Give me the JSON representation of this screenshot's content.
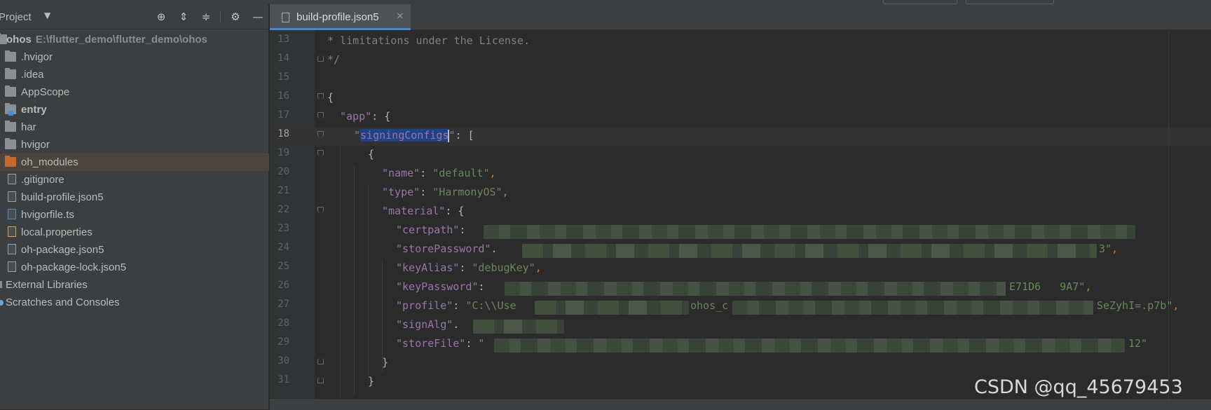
{
  "project_panel": {
    "title": "Project",
    "header_icons": [
      "crosshair-icon",
      "expand-all-icon",
      "collapse-all-icon",
      "gear-icon",
      "minimize-icon"
    ],
    "tree": [
      {
        "label": "ohos",
        "path": "E:\\flutter_demo\\flutter_demo\\ohos",
        "icon": "module-folder-icon"
      },
      {
        "label": ".hvigor",
        "icon": "folder-icon"
      },
      {
        "label": ".idea",
        "icon": "folder-icon"
      },
      {
        "label": "AppScope",
        "icon": "folder-icon"
      },
      {
        "label": "entry",
        "icon": "module-folder-icon"
      },
      {
        "label": "har",
        "icon": "folder-icon"
      },
      {
        "label": "hvigor",
        "icon": "folder-icon"
      },
      {
        "label": "oh_modules",
        "icon": "excluded-folder-icon"
      },
      {
        "label": ".gitignore",
        "icon": "gitignore-file-icon"
      },
      {
        "label": "build-profile.json5",
        "icon": "json-file-icon"
      },
      {
        "label": "hvigorfile.ts",
        "icon": "ts-file-icon"
      },
      {
        "label": "local.properties",
        "icon": "properties-file-icon"
      },
      {
        "label": "oh-package.json5",
        "icon": "json-file-icon"
      },
      {
        "label": "oh-package-lock.json5",
        "icon": "json-file-icon"
      },
      {
        "label": "External Libraries",
        "icon": "library-icon"
      },
      {
        "label": "Scratches and Consoles",
        "icon": "scratches-icon"
      }
    ]
  },
  "editor": {
    "tab_label": "build-profile.json5",
    "tab_close": "×",
    "current_line": 18,
    "lines": [
      {
        "n": "13",
        "text": "* limitations under the License."
      },
      {
        "n": "14",
        "text": "*/"
      },
      {
        "n": "15",
        "text": ""
      },
      {
        "n": "16",
        "text": "{"
      },
      {
        "n": "17",
        "key": "\"app\"",
        "rest": ": {"
      },
      {
        "n": "18",
        "pre": "\"",
        "selected": "signingConfigs",
        "post": "\"",
        "rest": ": ["
      },
      {
        "n": "19",
        "text": "{"
      },
      {
        "n": "20",
        "key": "\"name\"",
        "rest": ": ",
        "val": "\"default\"",
        "end": ","
      },
      {
        "n": "21",
        "key": "\"type\"",
        "rest": ": ",
        "val": "\"HarmonyOS\"",
        "end": ","
      },
      {
        "n": "22",
        "key": "\"material\"",
        "rest": ": {"
      },
      {
        "n": "23",
        "key": "\"certpath\"",
        "rest": ":"
      },
      {
        "n": "24",
        "key": "\"storePassword\"",
        "rest": ".",
        "val": "3\"",
        "end": ","
      },
      {
        "n": "25",
        "key": "\"keyAlias\"",
        "rest": ": ",
        "val": "\"debugKey\"",
        "end": ","
      },
      {
        "n": "26",
        "key": "\"keyPassword\"",
        "rest": ":",
        "val": "E71D6   9A7\"",
        "end": ","
      },
      {
        "n": "27",
        "key": "\"profile\"",
        "rest": ": ",
        "val": "\"C:\\\\Use",
        "val2": "ohos_c",
        "val3": "SeZyhI=.p7b\"",
        "end": ","
      },
      {
        "n": "28",
        "key": "\"signAlg\"",
        "rest": "."
      },
      {
        "n": "29",
        "key": "\"storeFile\"",
        "rest": ": ",
        "val": "\"",
        "val3": "12\""
      },
      {
        "n": "30",
        "text": "}"
      },
      {
        "n": "31",
        "text": "}"
      }
    ]
  },
  "watermark": "CSDN @qq_45679453"
}
